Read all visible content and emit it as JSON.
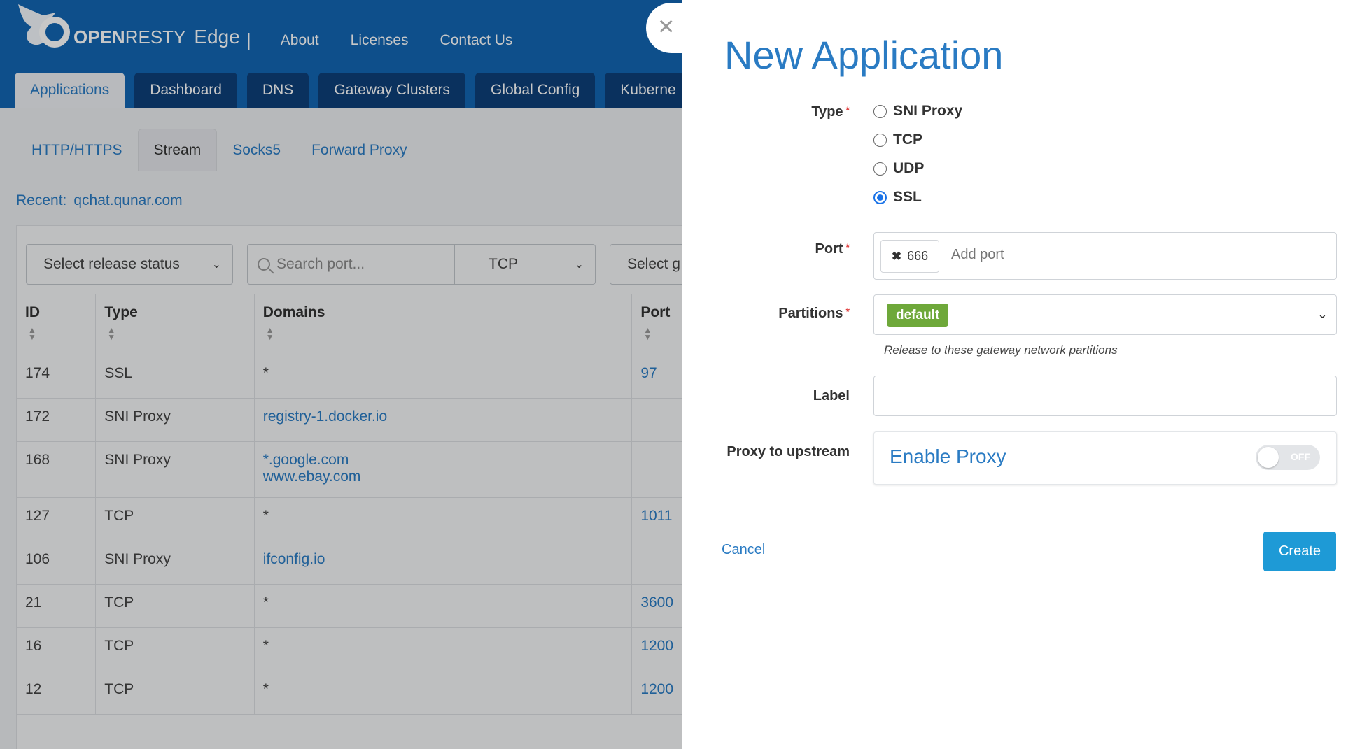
{
  "brand": {
    "logo_word_bold": "OPEN",
    "logo_word_rest": "RESTY",
    "product": "Edge",
    "separator": "|"
  },
  "topnav": [
    "About",
    "Licenses",
    "Contact Us"
  ],
  "main_tabs": [
    "Applications",
    "Dashboard",
    "DNS",
    "Gateway Clusters",
    "Global Config",
    "Kuberne"
  ],
  "sub_tabs": [
    "HTTP/HTTPS",
    "Stream",
    "Socks5",
    "Forward Proxy"
  ],
  "recent": {
    "label": "Recent:",
    "value": "qchat.qunar.com"
  },
  "filters": {
    "release_status": "Select release status",
    "search_placeholder": "Search port...",
    "protocol": "TCP",
    "gateway": "Select g"
  },
  "table": {
    "columns": [
      "ID",
      "Type",
      "Domains",
      "Port"
    ],
    "rows": [
      {
        "id": "174",
        "type": "SSL",
        "domains": [
          "*"
        ],
        "port": "97"
      },
      {
        "id": "172",
        "type": "SNI Proxy",
        "domains": [
          "registry-1.docker.io"
        ],
        "port": ""
      },
      {
        "id": "168",
        "type": "SNI Proxy",
        "domains": [
          "*.google.com",
          "www.ebay.com"
        ],
        "port": ""
      },
      {
        "id": "127",
        "type": "TCP",
        "domains": [
          "*"
        ],
        "port": "1011"
      },
      {
        "id": "106",
        "type": "SNI Proxy",
        "domains": [
          "ifconfig.io"
        ],
        "port": ""
      },
      {
        "id": "21",
        "type": "TCP",
        "domains": [
          "*"
        ],
        "port": "3600"
      },
      {
        "id": "16",
        "type": "TCP",
        "domains": [
          "*"
        ],
        "port": "1200"
      },
      {
        "id": "12",
        "type": "TCP",
        "domains": [
          "*"
        ],
        "port": "1200"
      }
    ]
  },
  "dialog": {
    "close_glyph": "×",
    "title": "New Application",
    "type_label": "Type",
    "type_options": [
      "SNI Proxy",
      "TCP",
      "UDP",
      "SSL"
    ],
    "type_selected": "SSL",
    "port_label": "Port",
    "port_tags": [
      "666"
    ],
    "port_tag_remove_glyph": "✖",
    "port_placeholder": "Add port",
    "partitions_label": "Partitions",
    "partitions_selected": "default",
    "partitions_help": "Release to these gateway network partitions",
    "label_label": "Label",
    "label_value": "",
    "proxy_label": "Proxy to upstream",
    "proxy_title": "Enable Proxy",
    "proxy_toggle_text": "OFF",
    "proxy_enabled": false,
    "cancel_label": "Cancel",
    "create_label": "Create",
    "required_mark": "*"
  },
  "colors": {
    "topbar": "#1266b3",
    "tab_dark": "#0d3f79",
    "link": "#2a7bc3",
    "badge": "#6ea83a",
    "primary_button": "#1e9ad6",
    "radio_checked": "#1a73e8",
    "required": "#e03b3b"
  }
}
